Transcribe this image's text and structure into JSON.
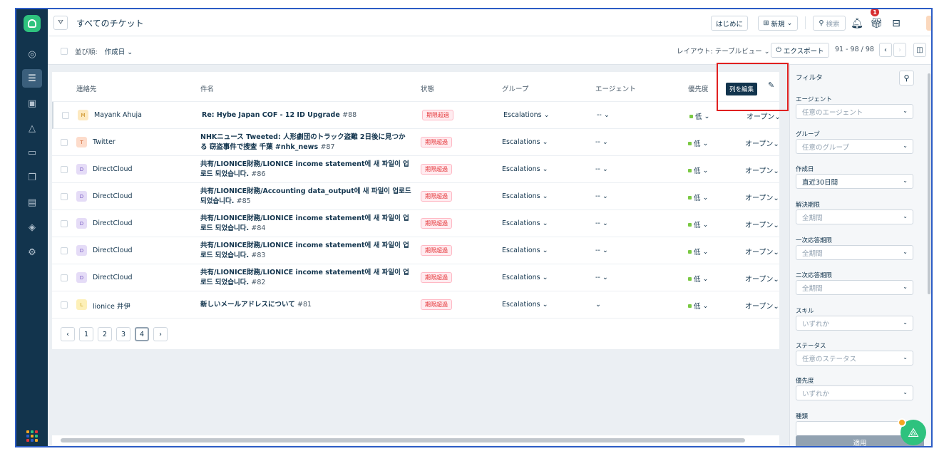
{
  "topbar": {
    "title": "すべてのチケット",
    "getting_started": "はじめに",
    "new_label": "新規",
    "search_label": "検索",
    "notification_count": "1"
  },
  "subbar": {
    "sort_label": "並び順:",
    "sort_value": "作成日",
    "layout_label": "レイアウト: テーブルビュー",
    "export_label": "エクスポート",
    "range": "91 - 98 / 98"
  },
  "table": {
    "headers": [
      "連絡先",
      "件名",
      "状態",
      "グループ",
      "エージェント",
      "優先度"
    ],
    "edit_columns_tooltip": "列を編集",
    "rows": [
      {
        "avatar": "M",
        "avatar_color": "#fde9c0",
        "contact": "Mayank Ahuja",
        "subject": "Re: Hybe Japan COF - 12 ID Upgrade",
        "number": "#88",
        "state": "期限超過",
        "group": "Escalations",
        "agent": "--",
        "priority": "低",
        "status": "オープン"
      },
      {
        "avatar": "T",
        "avatar_color": "#fddccb",
        "contact": "Twitter",
        "subject": "NHKニュース Tweeted: 人形劇団のトラック盗難 2日後に見つかる 窃盗事件で捜査 千葉 #nhk_news",
        "number": "#87",
        "state": "期限超過",
        "group": "Escalations",
        "agent": "--",
        "priority": "低",
        "status": "オープン"
      },
      {
        "avatar": "D",
        "avatar_color": "#e5dcf7",
        "contact": "DirectCloud",
        "subject": "共有/LIONICE財務/LIONICE income statement에 새 파일이 업로드 되었습니다.",
        "number": "#86",
        "state": "期限超過",
        "group": "Escalations",
        "agent": "--",
        "priority": "低",
        "status": "オープン"
      },
      {
        "avatar": "D",
        "avatar_color": "#e5dcf7",
        "contact": "DirectCloud",
        "subject": "共有/LIONICE財務/Accounting data_output에 새 파일이 업로드 되었습니다.",
        "number": "#85",
        "state": "期限超過",
        "group": "Escalations",
        "agent": "--",
        "priority": "低",
        "status": "オープン"
      },
      {
        "avatar": "D",
        "avatar_color": "#e5dcf7",
        "contact": "DirectCloud",
        "subject": "共有/LIONICE財務/LIONICE income statement에 새 파일이 업로드 되었습니다.",
        "number": "#84",
        "state": "期限超過",
        "group": "Escalations",
        "agent": "--",
        "priority": "低",
        "status": "オープン"
      },
      {
        "avatar": "D",
        "avatar_color": "#e5dcf7",
        "contact": "DirectCloud",
        "subject": "共有/LIONICE財務/LIONICE income statement에 새 파일이 업로드 되었습니다.",
        "number": "#83",
        "state": "期限超過",
        "group": "Escalations",
        "agent": "--",
        "priority": "低",
        "status": "オープン"
      },
      {
        "avatar": "D",
        "avatar_color": "#e5dcf7",
        "contact": "DirectCloud",
        "subject": "共有/LIONICE財務/LIONICE income statement에 새 파일이 업로드 되었습니다.",
        "number": "#82",
        "state": "期限超過",
        "group": "Escalations",
        "agent": "--",
        "priority": "低",
        "status": "オープン"
      },
      {
        "avatar": "L",
        "avatar_color": "#fdf0b8",
        "contact": "lionice 井伊",
        "subject": "新しいメールアドレスについて",
        "number": "#81",
        "state": "期限超過",
        "group": "Escalations",
        "agent": "",
        "priority": "低",
        "status": "オープン"
      }
    ],
    "pages": [
      "1",
      "2",
      "3",
      "4"
    ],
    "current_page": "4"
  },
  "filters": {
    "title": "フィルタ",
    "items": [
      {
        "label": "エージェント",
        "value": "任意のエージェント",
        "filled": false
      },
      {
        "label": "グループ",
        "value": "任意のグループ",
        "filled": false
      },
      {
        "label": "作成日",
        "value": "直近30日間",
        "filled": true
      },
      {
        "label": "解決期限",
        "value": "全期間",
        "filled": false
      },
      {
        "label": "一次応答期限",
        "value": "全期間",
        "filled": false
      },
      {
        "label": "二次応答期限",
        "value": "全期間",
        "filled": false
      },
      {
        "label": "スキル",
        "value": "いずれか",
        "filled": false
      },
      {
        "label": "ステータス",
        "value": "任意のステータス",
        "filled": false
      },
      {
        "label": "優先度",
        "value": "いずれか",
        "filled": false
      },
      {
        "label": "種類",
        "value": "",
        "filled": false
      }
    ],
    "apply_label": "適用"
  },
  "colors": {
    "nav_bg": "#12344d",
    "brand": "#2ec27e",
    "overdue_text": "#e43538",
    "priority_low": "#7ac943",
    "highlight": "#e02020"
  }
}
